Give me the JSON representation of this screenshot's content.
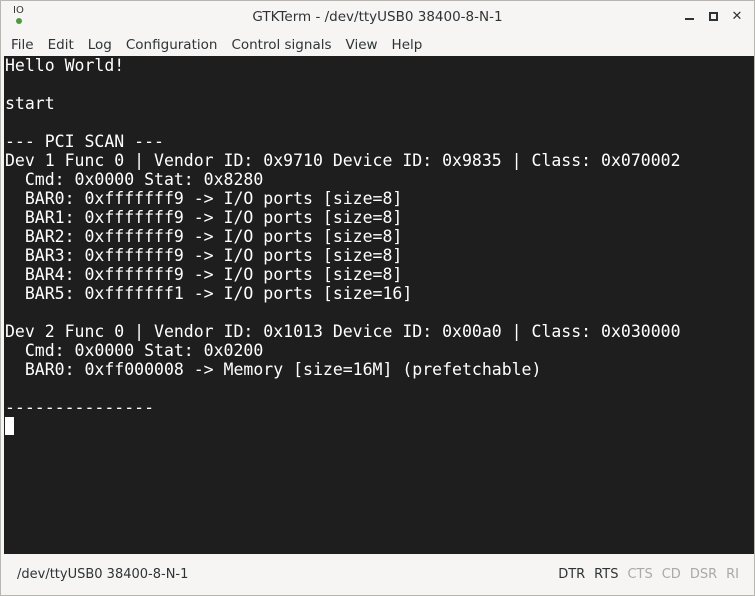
{
  "window": {
    "app_icon_text": "IO",
    "title": "GTKTerm - /dev/ttyUSB0  38400-8-N-1"
  },
  "menu": {
    "items": [
      "File",
      "Edit",
      "Log",
      "Configuration",
      "Control signals",
      "View",
      "Help"
    ]
  },
  "terminal": {
    "lines": [
      "Hello World!",
      "",
      "start",
      "",
      "--- PCI SCAN ---",
      "Dev 1 Func 0 | Vendor ID: 0x9710 Device ID: 0x9835 | Class: 0x070002",
      "  Cmd: 0x0000 Stat: 0x8280",
      "  BAR0: 0xfffffff9 -> I/O ports [size=8]",
      "  BAR1: 0xfffffff9 -> I/O ports [size=8]",
      "  BAR2: 0xfffffff9 -> I/O ports [size=8]",
      "  BAR3: 0xfffffff9 -> I/O ports [size=8]",
      "  BAR4: 0xfffffff9 -> I/O ports [size=8]",
      "  BAR5: 0xfffffff1 -> I/O ports [size=16]",
      "",
      "Dev 2 Func 0 | Vendor ID: 0x1013 Device ID: 0x00a0 | Class: 0x030000",
      "  Cmd: 0x0000 Stat: 0x0200",
      "  BAR0: 0xff000008 -> Memory [size=16M] (prefetchable)",
      "",
      "---------------"
    ],
    "background": "#1e1e1e",
    "foreground": "#ffffff"
  },
  "statusbar": {
    "port_info": "/dev/ttyUSB0  38400-8-N-1",
    "signals": [
      {
        "label": "DTR",
        "active": true
      },
      {
        "label": "RTS",
        "active": true
      },
      {
        "label": "CTS",
        "active": false
      },
      {
        "label": "CD",
        "active": false
      },
      {
        "label": "DSR",
        "active": false
      },
      {
        "label": "RI",
        "active": false
      }
    ]
  },
  "colors": {
    "chrome": "#f6f5f4",
    "signal_active": "#2e3436",
    "signal_inactive": "#a8aaa6"
  }
}
